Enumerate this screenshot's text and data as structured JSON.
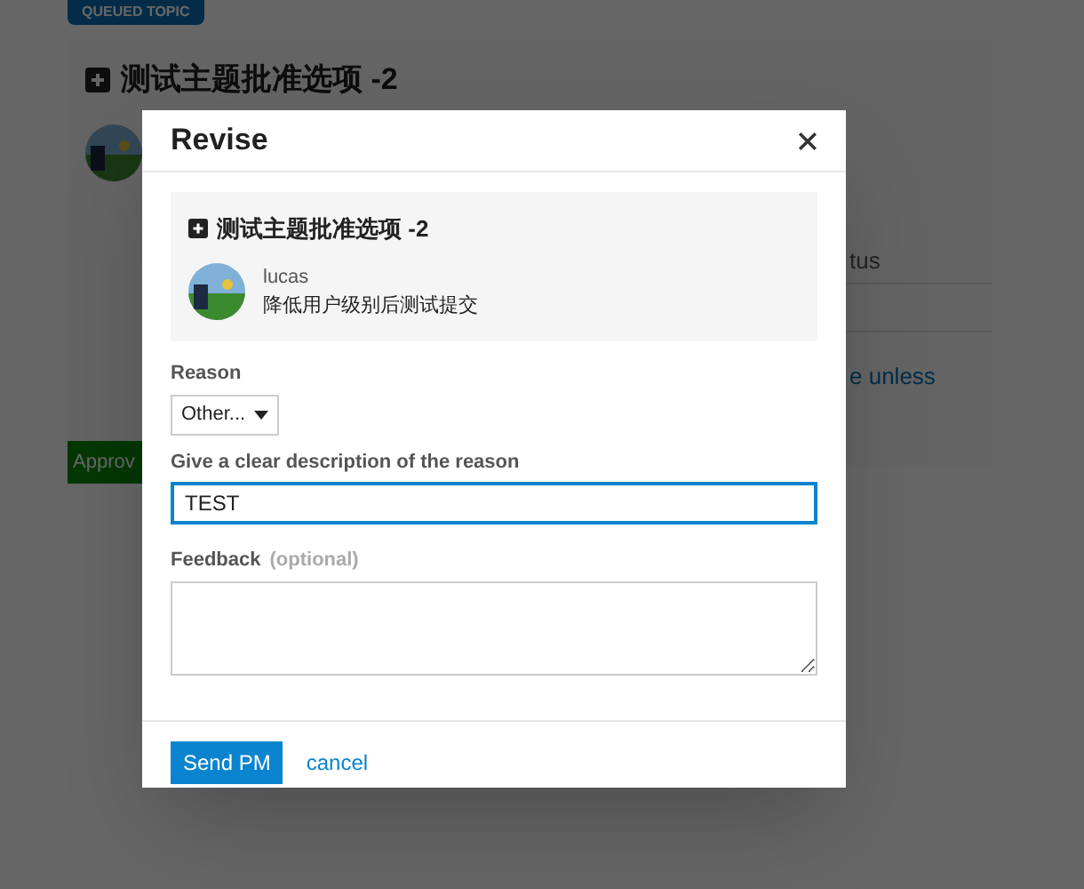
{
  "background": {
    "badge": "QUEUED TOPIC",
    "topic_title": "测试主题批准选项 -2",
    "fragment_1": "tus",
    "link_fragment": "e unless",
    "approve_button": "Approv"
  },
  "dialog": {
    "title": "Revise",
    "summary": {
      "title": "测试主题批准选项 -2",
      "username": "lucas",
      "excerpt": "降低用户级别后测试提交"
    },
    "reason": {
      "label": "Reason",
      "value": "Other..."
    },
    "description": {
      "label": "Give a clear description of the reason",
      "value": "TEST",
      "focused": true
    },
    "feedback": {
      "label": "Feedback",
      "optional_note": "(optional)"
    },
    "buttons": {
      "send": "Send PM",
      "cancel": "cancel"
    }
  }
}
